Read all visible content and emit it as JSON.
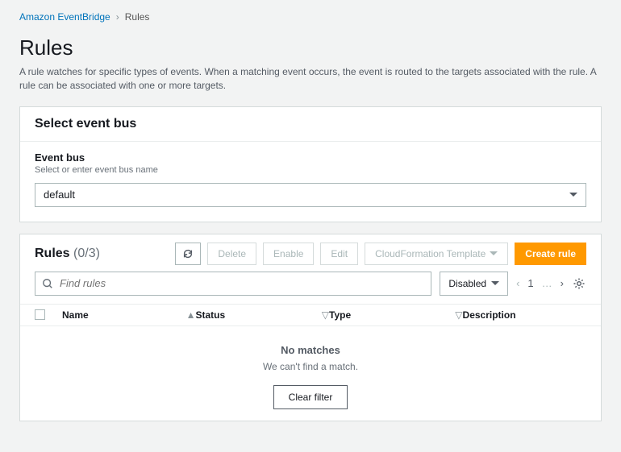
{
  "breadcrumb": {
    "root": "Amazon EventBridge",
    "current": "Rules"
  },
  "header": {
    "title": "Rules",
    "subtitle": "A rule watches for specific types of events. When a matching event occurs, the event is routed to the targets associated with the rule. A rule can be associated with one or more targets."
  },
  "event_bus_panel": {
    "title": "Select event bus",
    "field_label": "Event bus",
    "field_hint": "Select or enter event bus name",
    "selected": "default"
  },
  "rules_panel": {
    "title": "Rules",
    "count_display": "(0/3)",
    "buttons": {
      "delete": "Delete",
      "enable": "Enable",
      "edit": "Edit",
      "cf_template": "CloudFormation Template",
      "create": "Create rule"
    },
    "search_placeholder": "Find rules",
    "filter_dropdown": "Disabled",
    "page": "1",
    "columns": {
      "name": "Name",
      "status": "Status",
      "type": "Type",
      "description": "Description"
    },
    "empty": {
      "headline": "No matches",
      "sub": "We can't find a match.",
      "clear": "Clear filter"
    }
  }
}
